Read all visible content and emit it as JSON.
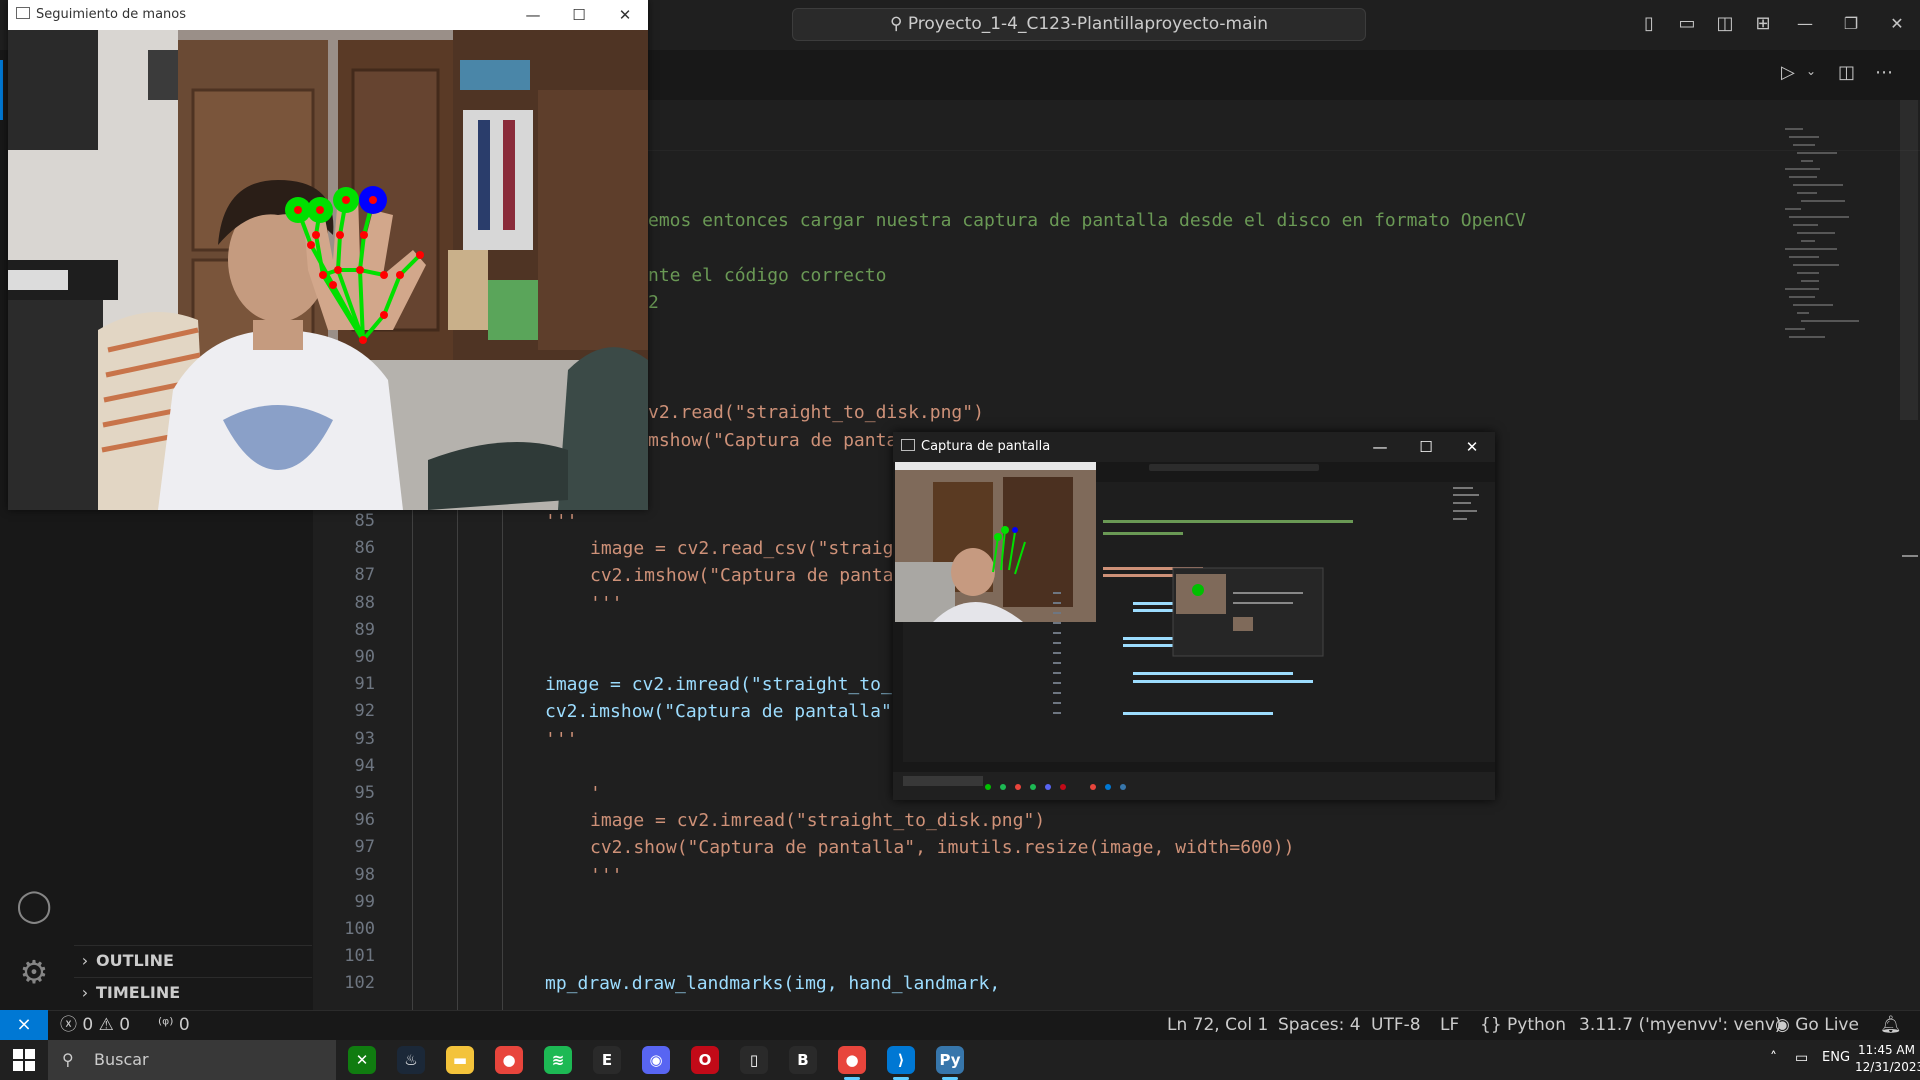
{
  "vscode": {
    "search_text": "Proyecto_1-4_C123-Plantillaproyecto-main",
    "sidebar_sections": [
      "OUTLINE",
      "TIMELINE"
    ],
    "editor_lines_top": [
      {
        "text": "emos entonces cargar nuestra captura de pantalla desde el disco en formato OpenCV",
        "kind": "comment"
      },
      {
        "text": "nte el código correcto",
        "kind": "comment"
      },
      {
        "text": "2",
        "kind": "comment"
      },
      {
        "text": "v2.read(\"straight_to_disk.png\")",
        "kind": "plain"
      },
      {
        "text": "mshow(\"Captura de panta",
        "kind": "plain"
      }
    ],
    "editor_lines": [
      {
        "num": "85",
        "code": "'''",
        "indent": 1
      },
      {
        "num": "86",
        "code": "image = cv2.read_csv(\"straig",
        "indent": 2
      },
      {
        "num": "87",
        "code": "cv2.imshow(\"Captura de panta",
        "indent": 2
      },
      {
        "num": "88",
        "code": "'''",
        "indent": 2
      },
      {
        "num": "89",
        "code": "",
        "indent": 0
      },
      {
        "num": "90",
        "code": "",
        "indent": 0
      },
      {
        "num": "91",
        "code": "image = cv2.imread(\"straight_to_",
        "indent": 1
      },
      {
        "num": "92",
        "code": "cv2.imshow(\"Captura de pantalla\"",
        "indent": 1
      },
      {
        "num": "93",
        "code": "'''",
        "indent": 1
      },
      {
        "num": "94",
        "code": "",
        "indent": 0
      },
      {
        "num": "95",
        "code": "'",
        "indent": 2
      },
      {
        "num": "96",
        "code": "image = cv2.imread(\"straight_to_disk.png\")",
        "indent": 2
      },
      {
        "num": "97",
        "code": "cv2.show(\"Captura de pantalla\", imutils.resize(image, width=600))",
        "indent": 2
      },
      {
        "num": "98",
        "code": "'''",
        "indent": 2
      },
      {
        "num": "99",
        "code": "",
        "indent": 0
      },
      {
        "num": "100",
        "code": "",
        "indent": 0
      },
      {
        "num": "101",
        "code": "",
        "indent": 0
      },
      {
        "num": "102",
        "code": "mp_draw.draw_landmarks(img, hand_landmark,",
        "indent": 1
      }
    ]
  },
  "status": {
    "errors": "0",
    "warnings": "0",
    "ports": "0",
    "position": "Ln 72, Col 1",
    "spaces": "Spaces: 4",
    "encoding": "UTF-8",
    "eol": "LF",
    "language": "Python",
    "interpreter": "3.11.7 ('myenvv': venv)",
    "go_live": "Go Live"
  },
  "taskbar": {
    "search_placeholder": "Buscar",
    "lang": "ENG",
    "time": "11:45 AM",
    "date": "12/31/2023",
    "apps": [
      {
        "name": "xbox",
        "color": "#107c10",
        "glyph": "✕"
      },
      {
        "name": "steam",
        "color": "#1b2838",
        "glyph": "♨"
      },
      {
        "name": "file-explorer",
        "color": "#f3c33b",
        "glyph": "▬"
      },
      {
        "name": "chrome",
        "color": "#e8453c",
        "glyph": "●"
      },
      {
        "name": "spotify",
        "color": "#1db954",
        "glyph": "≋"
      },
      {
        "name": "epic-games",
        "color": "#2a2a2a",
        "glyph": "E"
      },
      {
        "name": "discord",
        "color": "#5865f2",
        "glyph": "◉"
      },
      {
        "name": "opera",
        "color": "#c20a18",
        "glyph": "O"
      },
      {
        "name": "app-unknown",
        "color": "#2a2a2a",
        "glyph": "▯"
      },
      {
        "name": "app-bm",
        "color": "#2a2a2a",
        "glyph": "B"
      },
      {
        "name": "chrome-2",
        "color": "#e8453c",
        "glyph": "●"
      },
      {
        "name": "vscode",
        "color": "#0078d4",
        "glyph": "⟩"
      },
      {
        "name": "python",
        "color": "#3776ab",
        "glyph": "Py"
      }
    ]
  },
  "windows": {
    "cam_title": "Seguimiento de manos",
    "capture_title": "Captura de pantalla"
  },
  "colors": {
    "accent": "#0078d4",
    "editor_bg": "#1f1f1f",
    "landmark_green": "#00e000",
    "landmark_red": "#ff0000",
    "landmark_blue": "#0000ff"
  }
}
